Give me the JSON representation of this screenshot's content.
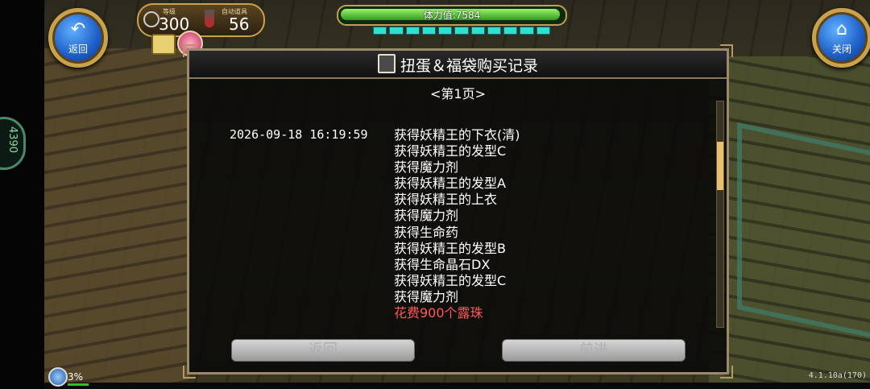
{
  "top_left_button": {
    "icon": "↶",
    "label": "返回"
  },
  "top_right_button": {
    "icon": "⌂",
    "label": "关闭"
  },
  "status": {
    "level_label": "等级",
    "level_value": "300",
    "auto_item_label": "自动道具",
    "auto_item_value": "56"
  },
  "stamina": {
    "text": "体力值:7584",
    "pip_count": 11
  },
  "dialog": {
    "title": "扭蛋＆福袋购买记录",
    "page_indicator": "<第1页>",
    "date": "2026-09-18  16:19:59",
    "items": [
      "获得妖精王的下衣(清)",
      "获得妖精王的发型C",
      "获得魔力剂",
      "获得妖精王的发型A",
      "获得妖精王的上衣",
      "获得魔力剂",
      "获得生命药",
      "获得妖精王的发型B",
      "获得生命晶石DX",
      "获得妖精王的发型C",
      "获得魔力剂"
    ],
    "cost": "花费900个露珠",
    "back_label": "返回",
    "forward_label": "前进"
  },
  "footer": {
    "progress": "3%",
    "version": "4.1.10a(170)"
  },
  "side_handle_text": "4390"
}
